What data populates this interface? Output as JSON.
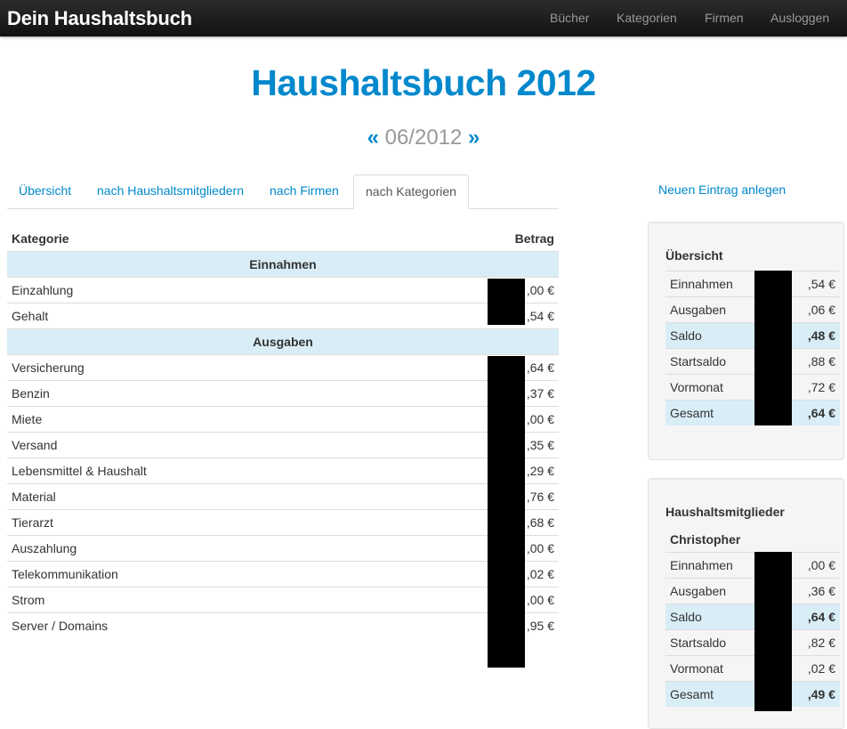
{
  "navbar": {
    "brand": "Dein Haushaltsbuch",
    "items": [
      "Bücher",
      "Kategorien",
      "Firmen",
      "Ausloggen"
    ]
  },
  "page": {
    "title": "Haushaltsbuch 2012",
    "prev_arrow": "«",
    "month": "06/2012",
    "next_arrow": "»"
  },
  "tabs": [
    "Übersicht",
    "nach Haushaltsmitgliedern",
    "nach Firmen",
    "nach Kategorien"
  ],
  "active_tab": "nach Kategorien",
  "new_entry_link": "Neuen Eintrag anlegen",
  "categories_table": {
    "headers": {
      "category": "Kategorie",
      "amount": "Betrag"
    },
    "income_label": "Einnahmen",
    "income": [
      {
        "name": "Einzahlung",
        "amount": ",00 €"
      },
      {
        "name": "Gehalt",
        "amount": ",54 €"
      }
    ],
    "expenses_label": "Ausgaben",
    "expenses": [
      {
        "name": "Versicherung",
        "amount": ",64 €"
      },
      {
        "name": "Benzin",
        "amount": ",37 €"
      },
      {
        "name": "Miete",
        "amount": ",00 €"
      },
      {
        "name": "Versand",
        "amount": ",35 €"
      },
      {
        "name": "Lebensmittel & Haushalt",
        "amount": ",29 €"
      },
      {
        "name": "Material",
        "amount": ",76 €"
      },
      {
        "name": "Tierarzt",
        "amount": ",68 €"
      },
      {
        "name": "Auszahlung",
        "amount": ",00 €"
      },
      {
        "name": "Telekommunikation",
        "amount": ",02 €"
      },
      {
        "name": "Strom",
        "amount": ",00 €"
      },
      {
        "name": "Server / Domains",
        "amount": ",95 €"
      }
    ]
  },
  "overview_panel": {
    "title": "Übersicht",
    "rows": [
      {
        "label": "Einnahmen",
        "amount": ",54 €",
        "highlight": false
      },
      {
        "label": "Ausgaben",
        "amount": ",06 €",
        "highlight": false
      },
      {
        "label": "Saldo",
        "amount": ",48 €",
        "highlight": true
      },
      {
        "label": "Startsaldo",
        "amount": ",88 €",
        "highlight": false
      },
      {
        "label": "Vormonat",
        "amount": ",72 €",
        "highlight": false
      },
      {
        "label": "Gesamt",
        "amount": ",64 €",
        "highlight": true
      }
    ]
  },
  "members_panel": {
    "title": "Haushaltsmitglieder",
    "member": "Christopher",
    "rows": [
      {
        "label": "Einnahmen",
        "amount": ",00 €",
        "highlight": false
      },
      {
        "label": "Ausgaben",
        "amount": ",36 €",
        "highlight": false
      },
      {
        "label": "Saldo",
        "amount": ",64 €",
        "highlight": true
      },
      {
        "label": "Startsaldo",
        "amount": ",82 €",
        "highlight": false
      },
      {
        "label": "Vormonat",
        "amount": ",02 €",
        "highlight": false
      },
      {
        "label": "Gesamt",
        "amount": ",49 €",
        "highlight": true
      }
    ]
  },
  "colors": {
    "accent": "#0088cc",
    "navbar": "#1b1b1b",
    "row_highlight": "#d9edf7",
    "redaction": "#000000"
  }
}
